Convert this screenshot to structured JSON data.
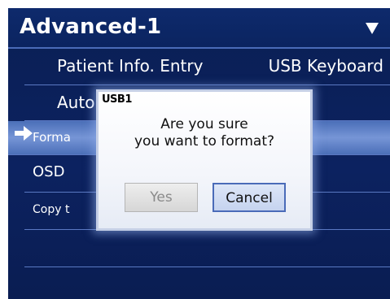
{
  "header": {
    "title": "Advanced-1",
    "dropdown_icon": "triangle-down-icon"
  },
  "menu": {
    "items": [
      {
        "label": "Patient Info. Entry",
        "value": "USB Keyboard"
      },
      {
        "label": "Auto",
        "value": ""
      },
      {
        "label": "Forma",
        "value": "",
        "selected": true,
        "indicator_icon": "arrow-right-icon"
      },
      {
        "label": "OSD",
        "value": ""
      },
      {
        "label": "Copy t",
        "value": ""
      },
      {
        "label": "",
        "value": ""
      },
      {
        "label": "",
        "value": ""
      }
    ]
  },
  "dialog": {
    "title": "USB1",
    "message_line1": "Are you sure",
    "message_line2": "you want to format?",
    "yes_label": "Yes",
    "cancel_label": "Cancel"
  },
  "colors": {
    "background": "#0c2260",
    "selected_row": "#7695d6",
    "divider": "#5a78c2",
    "dialog_border": "#c5cfe6"
  }
}
